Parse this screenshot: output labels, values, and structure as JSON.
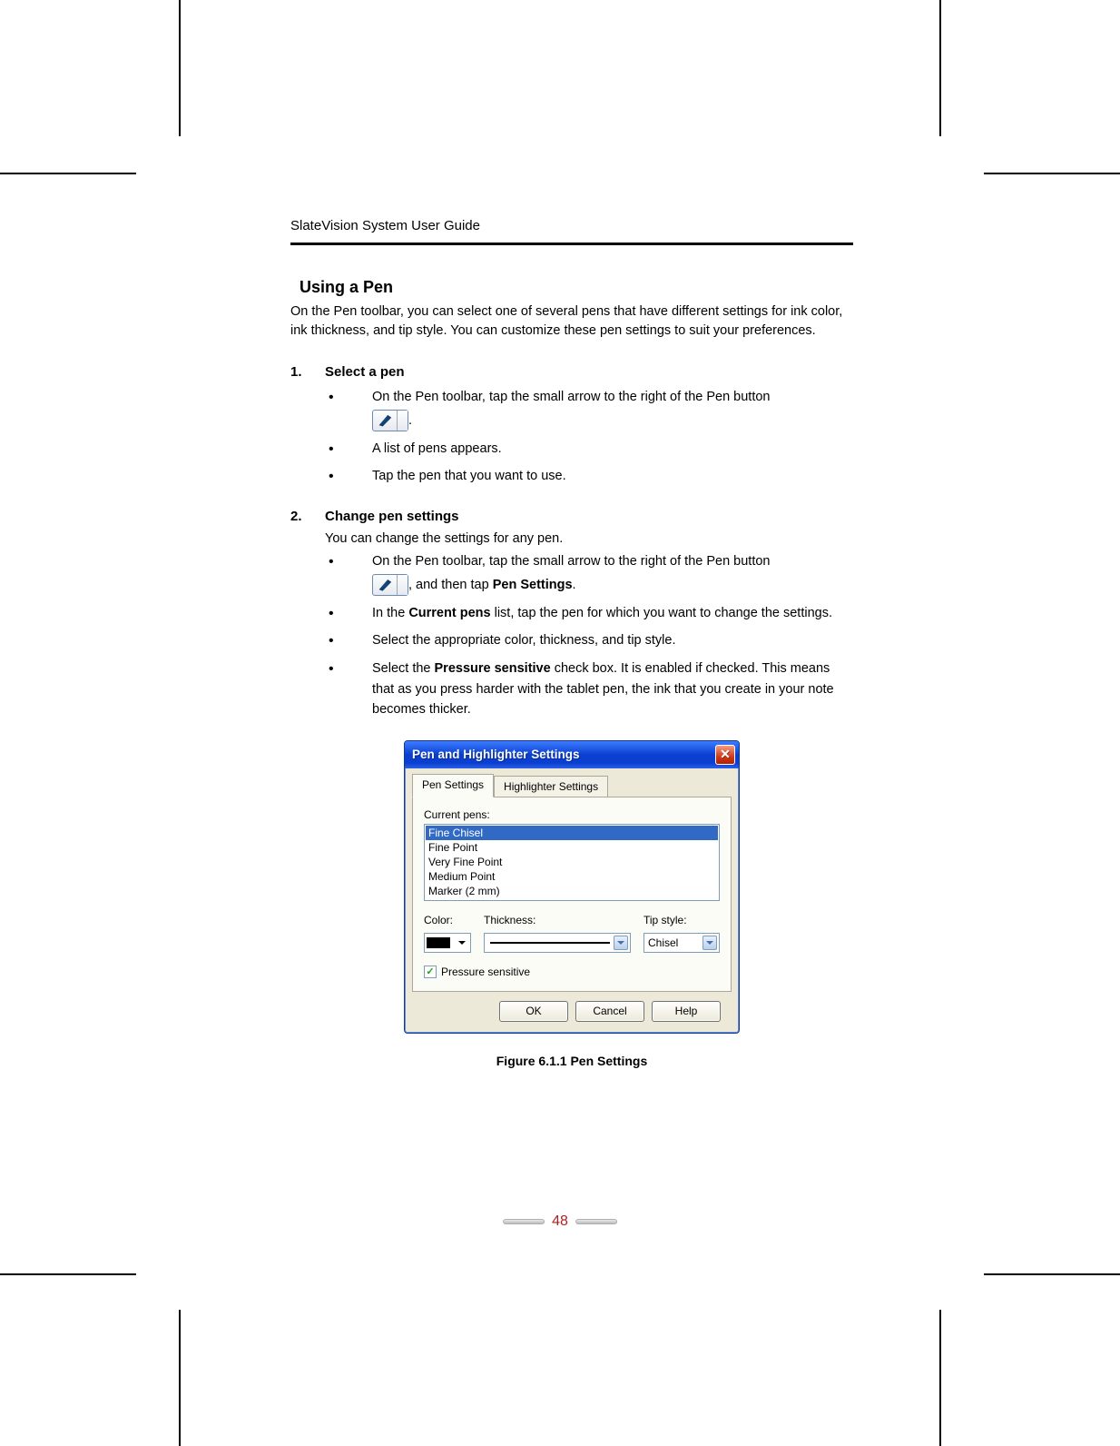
{
  "doc_header": "SlateVision System User Guide",
  "section_title": "Using a Pen",
  "intro": "On the Pen toolbar, you can select one of several pens that have different settings for ink color, ink thickness, and tip style. You can customize these pen settings to suit your preferences.",
  "steps": {
    "s1": {
      "num": "1.",
      "title": "Select a pen",
      "b1": "On the Pen toolbar, tap the small arrow to the right of the Pen button",
      "b1_tail": ".",
      "b2": "A list of pens appears.",
      "b3": "Tap the pen that you want to use."
    },
    "s2": {
      "num": "2.",
      "title": "Change pen settings",
      "desc": "You can change the settings for any pen.",
      "b1a": "On the Pen toolbar, tap the small arrow to the right of the Pen button",
      "b1b_pre": ", and then tap ",
      "b1b_bold": "Pen Settings",
      "b1b_post": ".",
      "b2_pre": "In the ",
      "b2_bold": "Current pens",
      "b2_post": " list, tap the pen for which you want to change the settings.",
      "b3": "Select the appropriate color, thickness, and tip style.",
      "b4_pre": "Select the ",
      "b4_bold": "Pressure sensitive",
      "b4_post": " check box. It is enabled if checked. This means that as you press harder with the tablet pen, the ink that you create in your note becomes thicker."
    }
  },
  "dialog": {
    "title": "Pen and Highlighter Settings",
    "tabs": {
      "t1": "Pen Settings",
      "t2": "Highlighter Settings"
    },
    "current_pens_label": "Current pens:",
    "pens": {
      "p0": "Fine Chisel",
      "p1": "Fine Point",
      "p2": "Very Fine Point",
      "p3": "Medium Point",
      "p4": "Marker (2 mm)"
    },
    "color_label": "Color:",
    "thickness_label": "Thickness:",
    "tip_label": "Tip style:",
    "tip_value": "Chisel",
    "pressure_label": "Pressure sensitive",
    "buttons": {
      "ok": "OK",
      "cancel": "Cancel",
      "help": "Help"
    }
  },
  "figure_caption": "Figure 6.1.1 Pen Settings",
  "page_number": "48"
}
